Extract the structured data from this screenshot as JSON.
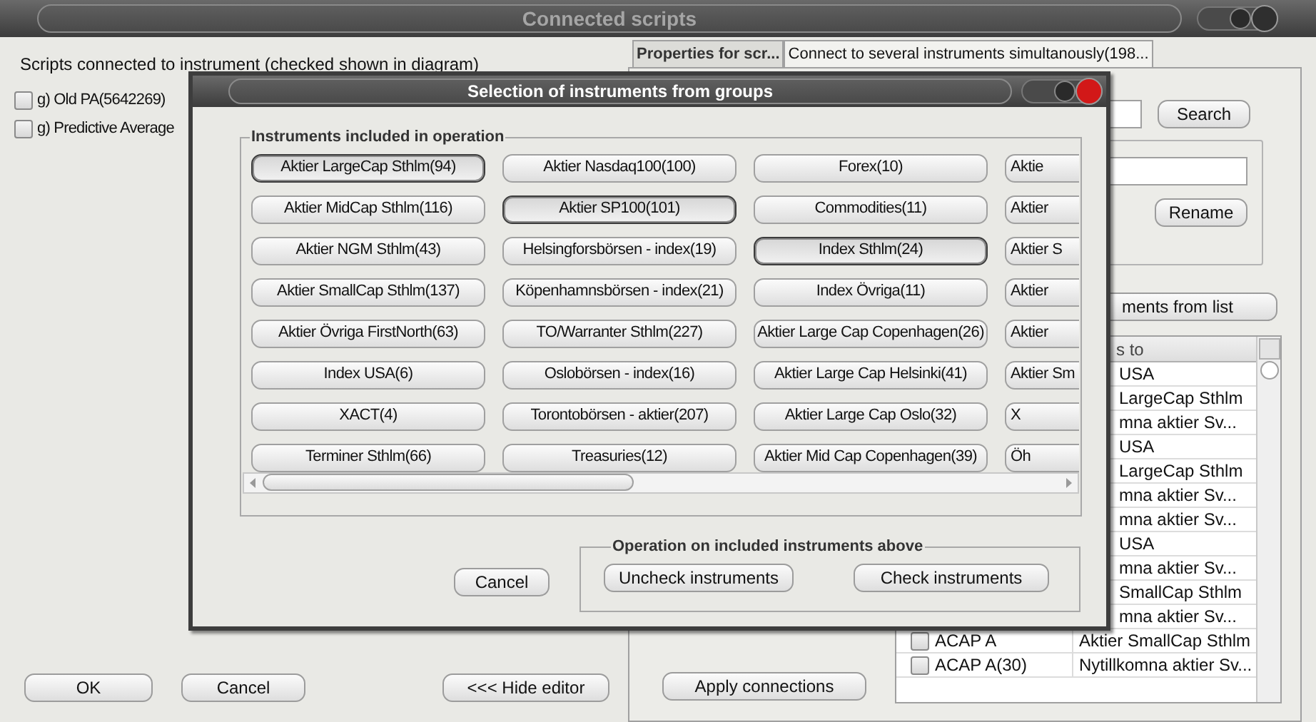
{
  "window": {
    "title": "Connected scripts"
  },
  "scripts_label": "Scripts connected to instrument (checked shown in diagram)",
  "scripts": [
    {
      "label": "g) Old PA(5642269)",
      "checked": false
    },
    {
      "label": "g) Predictive Average",
      "checked": false
    }
  ],
  "footer_buttons": [
    "OK",
    "Cancel",
    "<<< Hide editor"
  ],
  "tabs": [
    {
      "label": "Properties for scr...",
      "selected": false
    },
    {
      "label": "Connect to several instruments simultanously(198...",
      "selected": true
    }
  ],
  "search_button": "Search",
  "rename_button": "Rename",
  "list_button": "ments from list",
  "table": {
    "columns": [
      "s to"
    ],
    "rows": [
      {
        "group": "USA"
      },
      {
        "group": "LargeCap Sthlm"
      },
      {
        "group": "mna aktier Sv..."
      },
      {
        "group": "USA"
      },
      {
        "group": "LargeCap Sthlm"
      },
      {
        "group": "mna aktier Sv..."
      },
      {
        "group": "mna aktier Sv..."
      },
      {
        "group": "USA"
      },
      {
        "group": "mna aktier Sv..."
      },
      {
        "group": "SmallCap Sthlm"
      },
      {
        "group": "mna aktier Sv..."
      },
      {
        "name": "ACAP A",
        "group": "Aktier SmallCap Sthlm",
        "checked": false
      },
      {
        "name": "ACAP A(30)",
        "group": "Nytillkomna aktier Sv...",
        "checked": false
      }
    ]
  },
  "apply_button": "Apply connections",
  "dialog": {
    "title": "Selection of instruments from groups",
    "group_title": "Instruments included in operation",
    "groups": [
      {
        "label": "Aktier LargeCap Sthlm(94)",
        "selected": true
      },
      {
        "label": "Aktier Nasdaq100(100)",
        "selected": false
      },
      {
        "label": "Forex(10)",
        "selected": false
      },
      {
        "label": "Aktie",
        "selected": false
      },
      {
        "label": "Aktier MidCap Sthlm(116)",
        "selected": false
      },
      {
        "label": "Aktier SP100(101)",
        "selected": true
      },
      {
        "label": "Commodities(11)",
        "selected": false
      },
      {
        "label": "Aktier",
        "selected": false
      },
      {
        "label": "Aktier NGM Sthlm(43)",
        "selected": false
      },
      {
        "label": "Helsingforsbörsen - index(19)",
        "selected": false
      },
      {
        "label": "Index Sthlm(24)",
        "selected": true
      },
      {
        "label": "Aktier S",
        "selected": false
      },
      {
        "label": "Aktier SmallCap Sthlm(137)",
        "selected": false
      },
      {
        "label": "Köpenhamnsbörsen - index(21)",
        "selected": false
      },
      {
        "label": "Index Övriga(11)",
        "selected": false
      },
      {
        "label": "Aktier",
        "selected": false
      },
      {
        "label": "Aktier Övriga FirstNorth(63)",
        "selected": false
      },
      {
        "label": "TO/Warranter Sthlm(227)",
        "selected": false
      },
      {
        "label": "Aktier Large Cap Copenhagen(26)",
        "selected": false
      },
      {
        "label": "Aktier",
        "selected": false
      },
      {
        "label": "Index USA(6)",
        "selected": false
      },
      {
        "label": "Oslobörsen - index(16)",
        "selected": false
      },
      {
        "label": "Aktier Large Cap Helsinki(41)",
        "selected": false
      },
      {
        "label": "Aktier Sm",
        "selected": false
      },
      {
        "label": "XACT(4)",
        "selected": false
      },
      {
        "label": "Torontobörsen - aktier(207)",
        "selected": false
      },
      {
        "label": "Aktier Large Cap Oslo(32)",
        "selected": false
      },
      {
        "label": "X",
        "selected": false
      },
      {
        "label": "Terminer Sthlm(66)",
        "selected": false
      },
      {
        "label": "Treasuries(12)",
        "selected": false
      },
      {
        "label": "Aktier Mid Cap Copenhagen(39)",
        "selected": false
      },
      {
        "label": "Öh",
        "selected": false
      }
    ],
    "cancel_button": "Cancel",
    "operation_title": "Operation on included instruments above",
    "operation_buttons": [
      "Uncheck instruments",
      "Check instruments"
    ]
  }
}
